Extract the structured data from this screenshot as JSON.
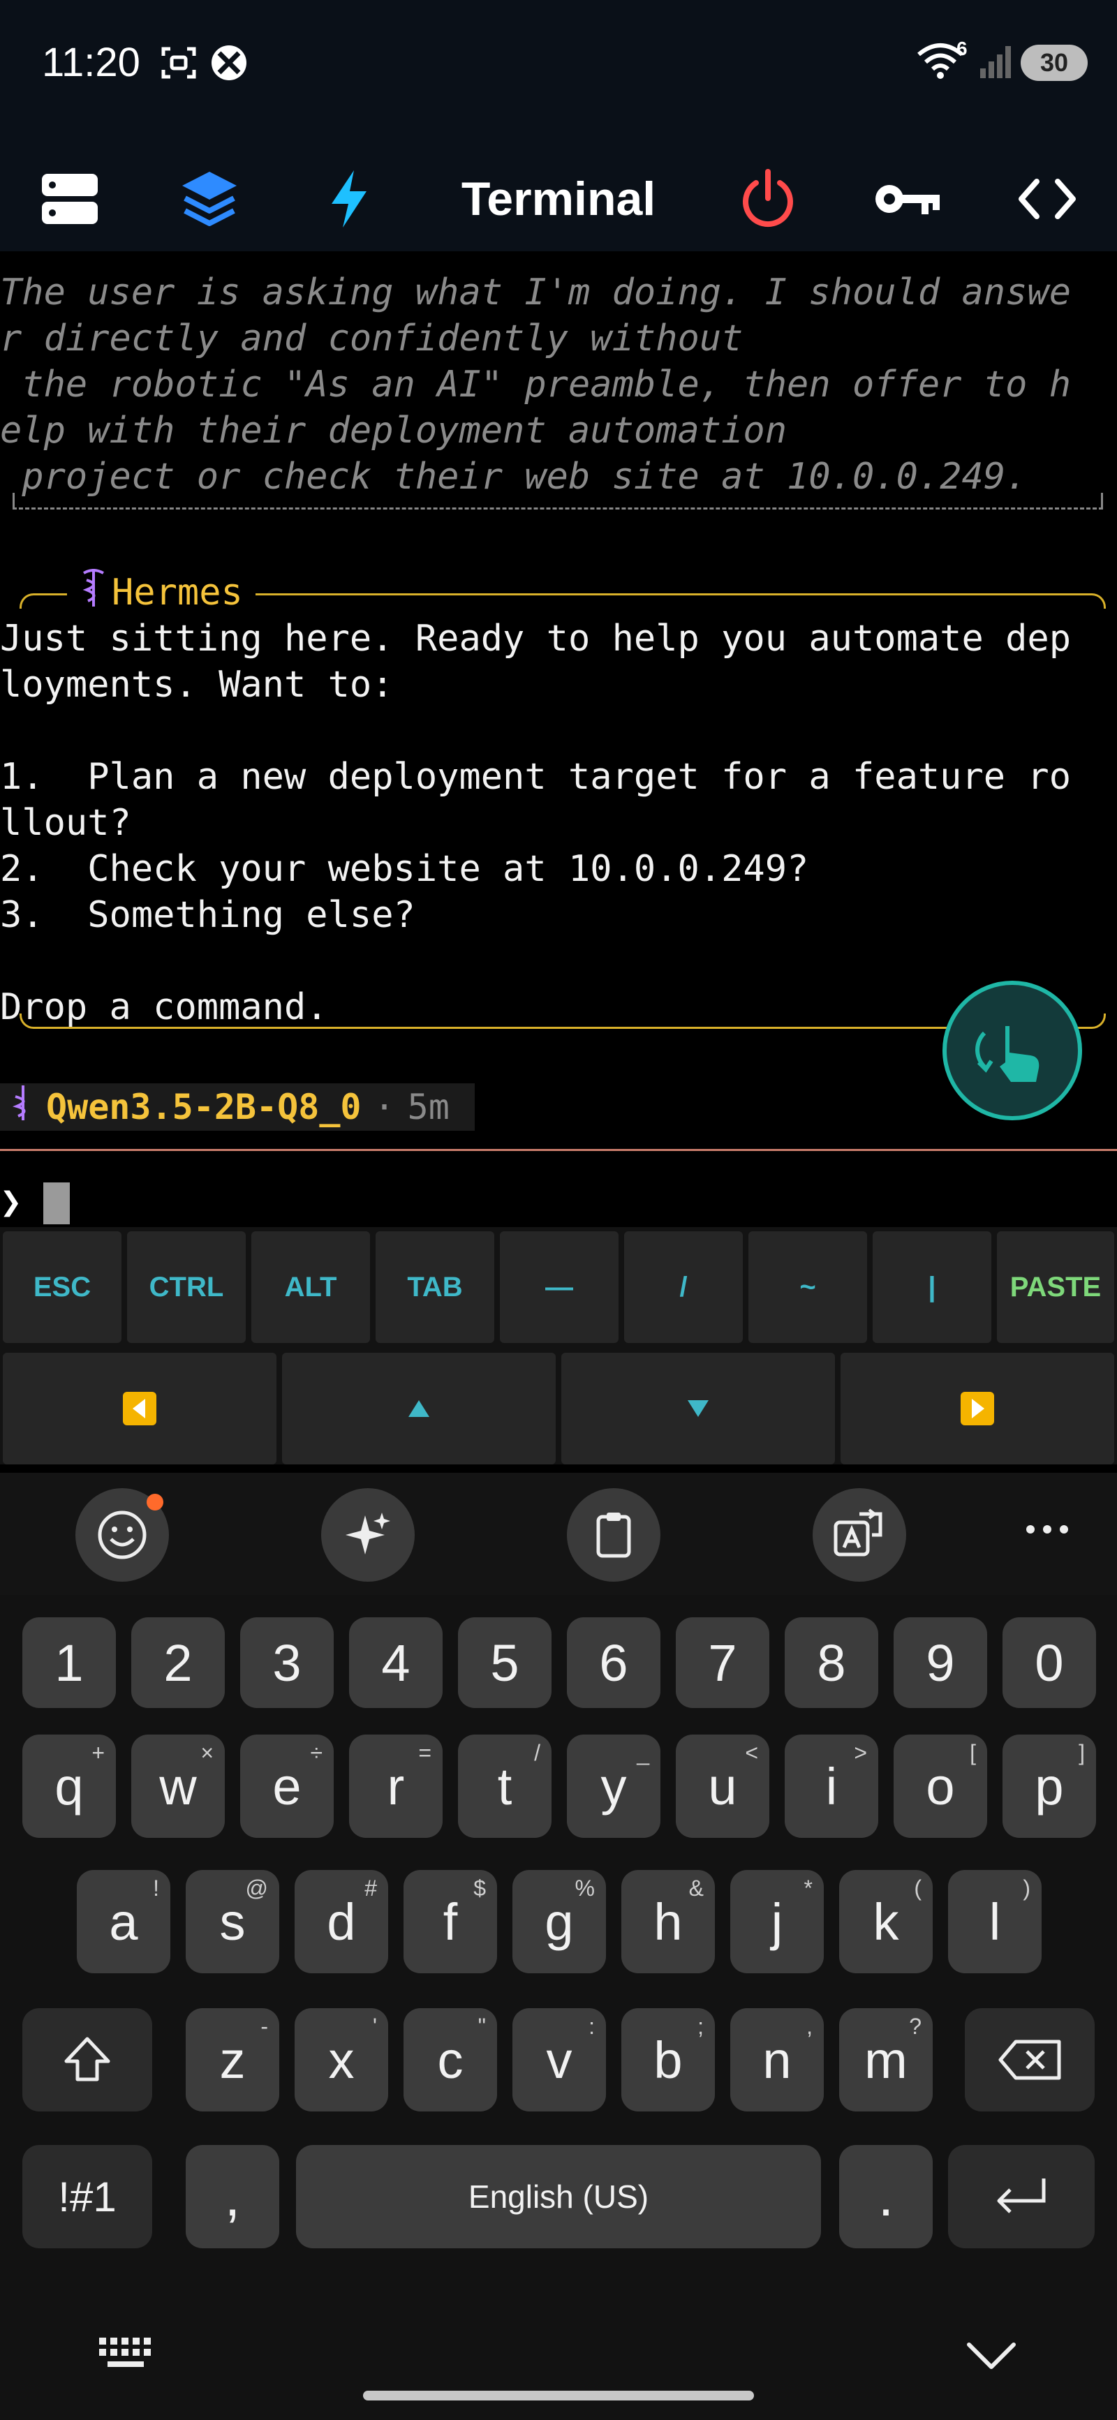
{
  "status": {
    "time": "11:20",
    "battery": "30",
    "wifi_badge": "6"
  },
  "toolbar": {
    "title": "Terminal",
    "icons": [
      "servers-icon",
      "layers-icon",
      "bolt-icon",
      "power-icon",
      "key-icon",
      "code-icon"
    ],
    "accent_colors": {
      "layers": "#2e8bff",
      "bolt": "#1ec0ff",
      "power": "#ff4b4b"
    }
  },
  "terminal": {
    "thinking_lines": [
      "The user is asking what I'm doing. I should answe",
      "r directly and confidently without",
      " the robotic \"As an AI\" preamble, then offer to h",
      "elp with their deployment automation",
      " project or check their web site at 10.0.0.249."
    ],
    "agent_name": "Hermes",
    "answer_lines": [
      "Just sitting here. Ready to help you automate dep",
      "loyments. Want to:",
      "",
      "1.  Plan a new deployment target for a feature ro",
      "llout?",
      "2.  Check your website at 10.0.0.249?",
      "3.  Something else?",
      "",
      "Drop a command."
    ],
    "model": "Qwen3.5-2B-Q8_0",
    "model_sep": "·",
    "elapsed": "5m",
    "prompt_symbol": "❯"
  },
  "extra_keys": {
    "row1": [
      "ESC",
      "CTRL",
      "ALT",
      "TAB",
      "—",
      "/",
      "~",
      "|",
      "PASTE"
    ],
    "row2": [
      "◀",
      "▲",
      "▼",
      "▶"
    ]
  },
  "keyboard": {
    "numbers": [
      "1",
      "2",
      "3",
      "4",
      "5",
      "6",
      "7",
      "8",
      "9",
      "0"
    ],
    "row_q": [
      [
        "q",
        "+"
      ],
      [
        "w",
        "×"
      ],
      [
        "e",
        "÷"
      ],
      [
        "r",
        "="
      ],
      [
        "t",
        "/"
      ],
      [
        "y",
        "_"
      ],
      [
        "u",
        "<"
      ],
      [
        "i",
        ">"
      ],
      [
        "o",
        "["
      ],
      [
        "p",
        "]"
      ]
    ],
    "row_a": [
      [
        "a",
        "!"
      ],
      [
        "s",
        "@"
      ],
      [
        "d",
        "#"
      ],
      [
        "f",
        "$"
      ],
      [
        "g",
        "%"
      ],
      [
        "h",
        "&"
      ],
      [
        "j",
        "*"
      ],
      [
        "k",
        "("
      ],
      [
        "l",
        ")"
      ]
    ],
    "row_z": [
      [
        "z",
        "-"
      ],
      [
        "x",
        "'"
      ],
      [
        "c",
        "\""
      ],
      [
        "v",
        ":"
      ],
      [
        "b",
        ";"
      ],
      [
        "n",
        ","
      ],
      [
        "m",
        "?"
      ]
    ],
    "symbols_key": "!#1",
    "comma_key": ",",
    "space_label": "English (US)",
    "period_key": "."
  }
}
